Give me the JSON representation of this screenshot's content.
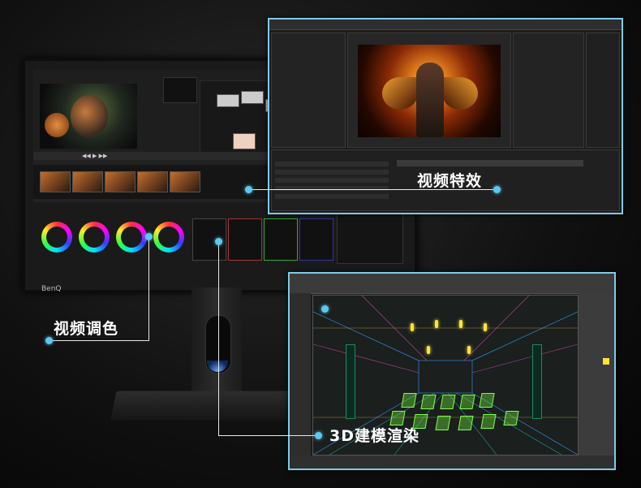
{
  "monitor": {
    "brand": "BenQ"
  },
  "callouts": {
    "video_effects": "视频特效",
    "video_grading": "视频调色",
    "modeling_rendering": "3D建模渲染"
  },
  "colors": {
    "accent": "#5bc8ee",
    "panel_border": "#7fcbe8",
    "wireframe_green": "#7dff4a",
    "light_yellow": "#ffe43a"
  }
}
